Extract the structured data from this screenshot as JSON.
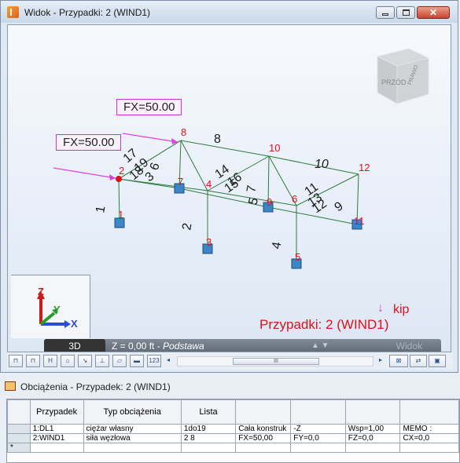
{
  "window": {
    "title": "Widok - Przypadki: 2 (WIND1)",
    "close_glyph": "✕"
  },
  "viewport": {
    "node_labels": [
      "1",
      "2",
      "3",
      "4",
      "5",
      "6",
      "7",
      "8",
      "9",
      "10",
      "11",
      "12"
    ],
    "member_labels": [
      "1",
      "2",
      "4",
      "6",
      "8",
      "10",
      "17",
      "18",
      "19",
      "3",
      "14",
      "15",
      "16",
      "5",
      "7",
      "11",
      "12",
      "13",
      "9"
    ],
    "load_labels": [
      "FX=50.00",
      "FX=50.00"
    ],
    "case_text": "Przypadki: 2 (WIND1)",
    "unit_text": "kip",
    "cube_front": "PRZÓD",
    "cube_right": "PRAWO",
    "axes": {
      "z": "Z",
      "y": "Y",
      "x": "X"
    },
    "colors": {
      "node_label": "#e0101a",
      "member": "#2e7a3e",
      "load": "#e040e0",
      "support": "#3a86c8"
    }
  },
  "statusbar": {
    "mode": "3D",
    "z_level": "Z = 0,00 ft - ",
    "z_level_name": "Podstawa",
    "view_btn": "Widok"
  },
  "toolbar": {
    "scroll_label": "III",
    "icons": [
      "node-numbers-icon",
      "member-numbers-icon",
      "sections-icon",
      "supports-icon",
      "loads-icon",
      "releases-icon",
      "offsets-icon",
      "panels-icon",
      "numbers-123-icon",
      "display-icon",
      "zoom-icon",
      "print-icon"
    ]
  },
  "panel": {
    "title": "Obciążenia - Przypadek: 2 (WIND1)",
    "headers": [
      "Przypadek",
      "Typ obciążenia",
      "Lista",
      "",
      "",
      "",
      ""
    ],
    "rows": [
      [
        "1:DL1",
        "ciężar własny",
        "1do19",
        "Cała konstruk",
        "-Z",
        "Wsp=1,00",
        "MEMO :"
      ],
      [
        "2:WIND1",
        "siła węzłowa",
        "2 8",
        "FX=50,00",
        "FY=0,0",
        "FZ=0,0",
        "CX=0,0"
      ],
      [
        "",
        "",
        "",
        "",
        "",
        "",
        ""
      ]
    ],
    "new_row_marker": "*"
  }
}
